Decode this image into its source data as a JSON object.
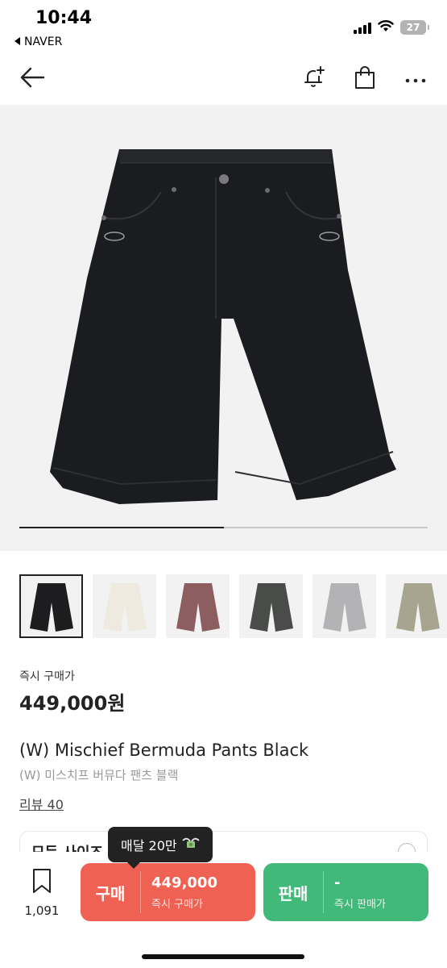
{
  "status_bar": {
    "time": "10:44",
    "back_app": "NAVER",
    "battery": "27"
  },
  "header": {
    "back_icon": "arrow-left-icon",
    "notify_icon": "bell-plus-icon",
    "bag_icon": "shopping-bag-icon",
    "more_icon": "more-dots-icon"
  },
  "product": {
    "image_progress": 0.5,
    "price_label": "즉시 구매가",
    "price": "449,000원",
    "title_en": "(W) Mischief Bermuda Pants Black",
    "title_ko": "(W) 미스치프 버뮤다 팬츠 블랙",
    "review_link": "리뷰 40",
    "size_label": "모든 사이즈"
  },
  "thumbnails": [
    {
      "color": "#1d1d1f",
      "selected": true
    },
    {
      "color": "#efeae0",
      "selected": false
    },
    {
      "color": "#8c5e60",
      "selected": false
    },
    {
      "color": "#4a4c4a",
      "selected": false
    },
    {
      "color": "#b3b3b5",
      "selected": false
    },
    {
      "color": "#a7a58f",
      "selected": false
    }
  ],
  "tooltip": {
    "text": "매달 20만"
  },
  "bottom_bar": {
    "bookmark_count": "1,091",
    "buy_label": "구매",
    "buy_value": "449,000",
    "buy_sub": "즉시 구매가",
    "sell_label": "판매",
    "sell_value": "-",
    "sell_sub": "즉시 판매가"
  },
  "colors": {
    "buy": "#ef6253",
    "sell": "#41b979",
    "image_bg": "#f2f2f2"
  }
}
